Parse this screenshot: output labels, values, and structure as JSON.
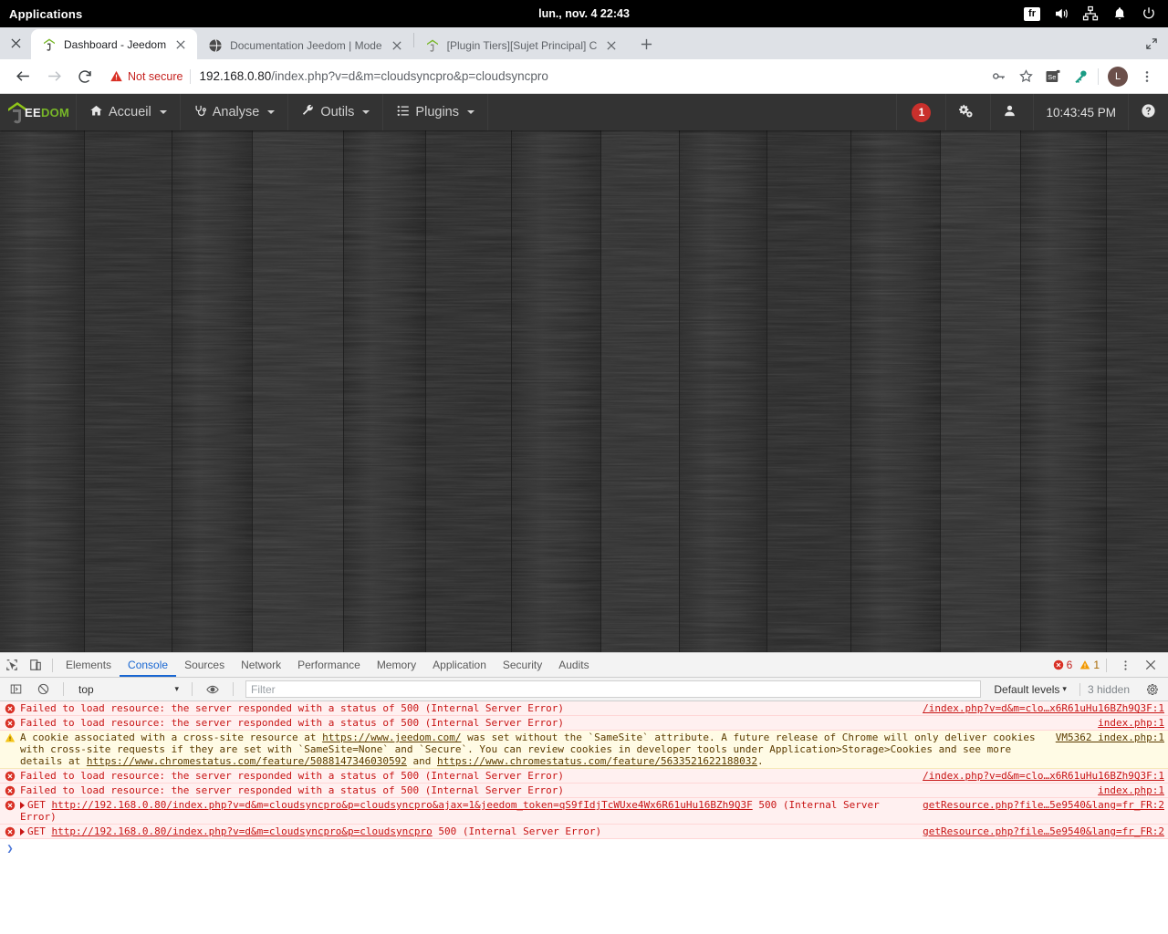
{
  "desktop": {
    "applications_label": "Applications",
    "clock": "lun., nov. 4   22:43",
    "keyboard_layout": "fr",
    "tray_icons": [
      "volume-icon",
      "network-icon",
      "notifications-icon",
      "power-icon"
    ]
  },
  "browser": {
    "tabs": [
      {
        "title": "Dashboard - Jeedom",
        "favicon": "jeedom-favicon",
        "active": true
      },
      {
        "title": "Documentation Jeedom | Mode",
        "favicon": "globe-favicon",
        "active": false
      },
      {
        "title": "[Plugin Tiers][Sujet Principal] C",
        "favicon": "jeedom-favicon",
        "active": false
      }
    ],
    "new_tab_label": "+",
    "window_close_label": "×",
    "window_restore_label": "⤡",
    "omnibox": {
      "security_label": "Not secure",
      "url_host": "192.168.0.80",
      "url_path": "/index.php?v=d&m=cloudsyncpro&p=cloudsyncpro"
    },
    "toolbar_icons": [
      "key-icon",
      "star-icon",
      "selenium-icon",
      "keepass-icon"
    ],
    "profile_initial": "L",
    "menu_icon": "kebab-menu-icon"
  },
  "jeedom": {
    "logo_ee": "EE",
    "logo_dom": "DOM",
    "nav": [
      {
        "label": "Accueil",
        "icon": "home-icon"
      },
      {
        "label": "Analyse",
        "icon": "stethoscope-icon"
      },
      {
        "label": "Outils",
        "icon": "wrench-icon"
      },
      {
        "label": "Plugins",
        "icon": "list-icon"
      }
    ],
    "badge_count": "1",
    "gear_label": "",
    "user_label": "",
    "clock": "10:43:45 PM",
    "help_icon": "help-icon"
  },
  "devtools": {
    "inspect_icon": "inspect-element-icon",
    "device_icon": "toggle-device-toolbar-icon",
    "tabs": [
      {
        "label": "Elements",
        "active": false
      },
      {
        "label": "Console",
        "active": true
      },
      {
        "label": "Sources",
        "active": false
      },
      {
        "label": "Network",
        "active": false
      },
      {
        "label": "Performance",
        "active": false
      },
      {
        "label": "Memory",
        "active": false
      },
      {
        "label": "Application",
        "active": false
      },
      {
        "label": "Security",
        "active": false
      },
      {
        "label": "Audits",
        "active": false
      }
    ],
    "error_count": "6",
    "warning_count": "1",
    "more_icon": "kebab-menu-icon",
    "close_icon": "close-icon",
    "console_bar": {
      "sidebar_icon": "console-sidebar-icon",
      "clear_icon": "clear-console-icon",
      "context": "top",
      "eye_icon": "live-expression-icon",
      "filter_placeholder": "Filter",
      "levels_label": "Default levels",
      "hidden_label": "3 hidden",
      "settings_icon": "gear-icon"
    },
    "messages": [
      {
        "type": "error",
        "text": "Failed to load resource: the server responded with a status of 500 (Internal Server Error)",
        "source": "/index.php?v=d&m=clo…x6R61uHu16BZh9Q3F:1"
      },
      {
        "type": "error",
        "text": "Failed to load resource: the server responded with a status of 500 (Internal Server Error)",
        "source": "index.php:1"
      },
      {
        "type": "warn",
        "text_parts": [
          {
            "t": "A cookie associated with a cross-site resource at ",
            "link": false
          },
          {
            "t": "https://www.jeedom.com/",
            "link": true
          },
          {
            "t": " was set without the `SameSite` attribute. A future release of Chrome will only deliver cookies with cross-site requests if they are set with `SameSite=None` and `Secure`. You can review cookies in developer tools under Application>Storage>Cookies and see more details at ",
            "link": false
          },
          {
            "t": "https://www.chromestatus.com/feature/5088147346030592",
            "link": true
          },
          {
            "t": " and ",
            "link": false
          },
          {
            "t": "https://www.chromestatus.com/feature/5633521622188032",
            "link": true
          },
          {
            "t": ".",
            "link": false
          }
        ],
        "source": "VM5362 index.php:1"
      },
      {
        "type": "error",
        "text": "Failed to load resource: the server responded with a status of 500 (Internal Server Error)",
        "source": "/index.php?v=d&m=clo…x6R61uHu16BZh9Q3F:1"
      },
      {
        "type": "error",
        "text": "Failed to load resource: the server responded with a status of 500 (Internal Server Error)",
        "source": "index.php:1"
      },
      {
        "type": "error",
        "expandable": true,
        "prefix": "GET ",
        "url": "http://192.168.0.80/index.php?v=d&m=cloudsyncpro&p=cloudsyncpro&ajax=1&jeedom_token=qS9fIdjTcWUxe4Wx6R61uHu16BZh9Q3F",
        "suffix": " 500 (Internal Server Error)",
        "source": "getResource.php?file…5e9540&lang=fr_FR:2"
      },
      {
        "type": "error",
        "expandable": true,
        "prefix": "GET ",
        "url": "http://192.168.0.80/index.php?v=d&m=cloudsyncpro&p=cloudsyncpro",
        "suffix": " 500 (Internal Server Error)",
        "source": "getResource.php?file…5e9540&lang=fr_FR:2"
      }
    ],
    "prompt_symbol": "❯"
  },
  "colors": {
    "error_red": "#c81414",
    "warn_yellow": "#fffbe5",
    "accent_blue": "#1967d2",
    "jeedom_green": "#78b728",
    "badge_red": "#c9302c"
  }
}
